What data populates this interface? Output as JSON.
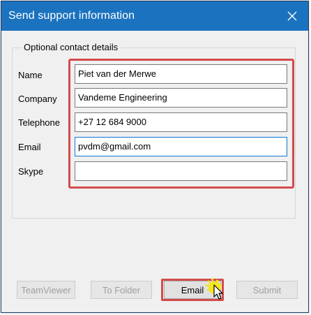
{
  "window": {
    "title": "Send support information",
    "close_icon": "close-icon",
    "accent_color": "#1b73bf",
    "highlight_color": "#d34b4b"
  },
  "group": {
    "legend": "Optional contact details"
  },
  "fields": {
    "name": {
      "label": "Name",
      "value": "Piet van der Merwe"
    },
    "company": {
      "label": "Company",
      "value": "Vandeme Engineering"
    },
    "telephone": {
      "label": "Telephone",
      "value": "+27 12 684 9000"
    },
    "email": {
      "label": "Email",
      "value": "pvdm@gmail.com"
    },
    "skype": {
      "label": "Skype",
      "value": ""
    }
  },
  "buttons": {
    "teamviewer": "TeamViewer",
    "to_folder": "To Folder",
    "email": "Email",
    "submit": "Submit"
  }
}
